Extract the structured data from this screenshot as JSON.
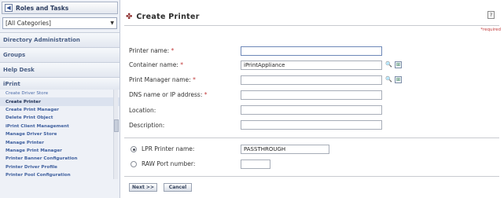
{
  "sidebar": {
    "header": "Roles and Tasks",
    "category_select": "[All Categories]",
    "groups": [
      {
        "label": "Directory Administration"
      },
      {
        "label": "Groups"
      },
      {
        "label": "Help Desk"
      }
    ],
    "open_group": "iPrint",
    "tasks": [
      "Create Driver Store",
      "Create Printer",
      "Create Print Manager",
      "Delete Print Object",
      "iPrint Client Management",
      "Manage Driver Store",
      "Manage Printer",
      "Manage Print Manager",
      "Printer Banner Configuration",
      "Printer Driver Profile",
      "Printer Pool Configuration"
    ]
  },
  "main": {
    "title": "Create Printer",
    "help": "?",
    "required_note": "*required",
    "fields": {
      "printer_name": {
        "label": "Printer name:",
        "req": "*",
        "value": ""
      },
      "container_name": {
        "label": "Container name:",
        "req": "*",
        "value": "iPrintAppliance"
      },
      "print_manager_name": {
        "label": "Print Manager name:",
        "req": "*",
        "value": ""
      },
      "dns_ip": {
        "label": "DNS name or IP address:",
        "req": "*",
        "value": ""
      },
      "location": {
        "label": "Location:",
        "value": ""
      },
      "description": {
        "label": "Description:",
        "value": ""
      }
    },
    "lpr": {
      "label": "LPR Printer name:",
      "value": "PASSTHROUGH",
      "checked": true
    },
    "raw": {
      "label": "RAW Port number:",
      "value": "",
      "checked": false
    },
    "buttons": {
      "next": "Next >>",
      "cancel": "Cancel"
    }
  }
}
